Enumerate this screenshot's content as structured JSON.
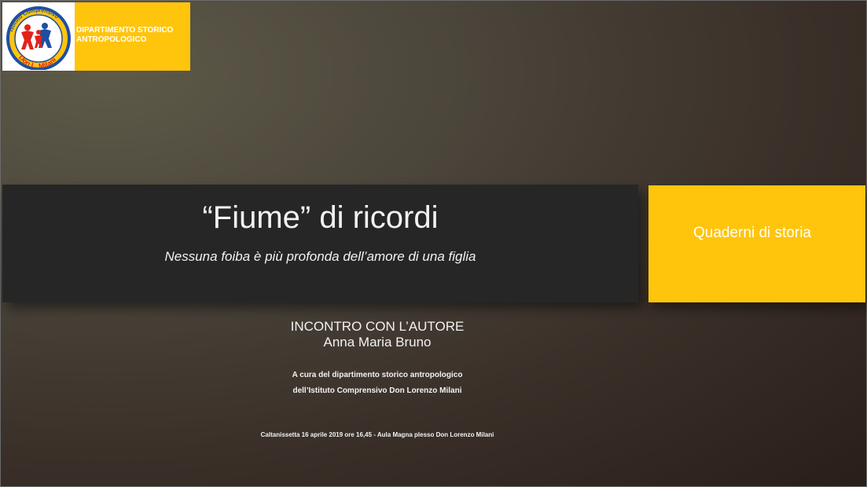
{
  "header": {
    "logo_text_top": "Istituto Comprensivo",
    "logo_text_name": "Don L. Milani",
    "logo_text_city": "Caltanissetta",
    "department": "DIPARTIMENTO STORICO ANTROPOLOGICO"
  },
  "title_band": {
    "title": "“Fiume” di ricordi",
    "subtitle": "Nessuna foiba è più profonda dell’amore di una figlia"
  },
  "side_box": {
    "label": "Quaderni di storia"
  },
  "event": {
    "heading": "INCONTRO CON L’AUTORE",
    "author": "Anna Maria Bruno",
    "curated_line1": "A cura del dipartimento storico antropologico",
    "curated_line2": "dell’Istituto Comprensivo Don Lorenzo Milani",
    "footer": "Caltanissetta 16 aprile 2019 ore 16,45  - Aula Magna plesso Don Lorenzo Milani"
  },
  "colors": {
    "accent_yellow": "#ffc50c",
    "band_dark": "#262626",
    "logo_blue": "#1e4fa3",
    "logo_red": "#e2231a"
  }
}
